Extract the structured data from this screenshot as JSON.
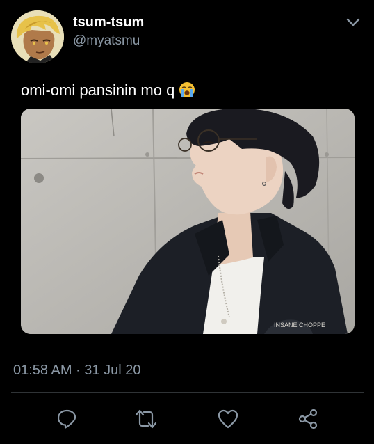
{
  "tweet": {
    "display_name": "tsum-tsum",
    "handle": "@myatsmu",
    "text": "omi-omi pansinin mo q",
    "emoji": "loudly-crying-face",
    "timestamp": "01:58 AM · 31 Jul 20",
    "media": {
      "print_text": "INSANE CHOPPE"
    }
  },
  "actions": [
    {
      "icon": "reply-icon"
    },
    {
      "icon": "retweet-icon"
    },
    {
      "icon": "like-icon"
    },
    {
      "icon": "share-icon"
    }
  ],
  "colors": {
    "background": "#000000",
    "primary_text": "#ffffff",
    "secondary_text": "#8b98a5",
    "divider": "#2f3336",
    "icon": "#8b98a5"
  }
}
